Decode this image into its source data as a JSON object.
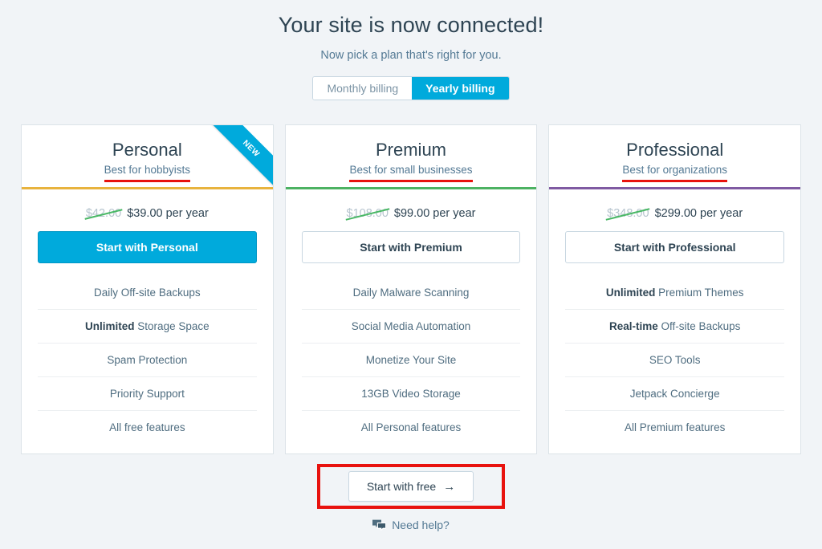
{
  "header": {
    "title": "Your site is now connected!",
    "subtitle": "Now pick a plan that's right for you."
  },
  "billing": {
    "monthly_label": "Monthly billing",
    "yearly_label": "Yearly billing",
    "selected": "Yearly billing"
  },
  "plans": [
    {
      "name": "Personal",
      "tagline": "Best for hobbyists",
      "accent_color": "#e8b33d",
      "ribbon": "NEW",
      "price_old": "$42.00",
      "price_new": "$39.00 per year",
      "cta_label": "Start with Personal",
      "cta_style": "filled",
      "features": [
        {
          "bold": "",
          "text": "Daily Off-site Backups"
        },
        {
          "bold": "Unlimited",
          "text": " Storage Space"
        },
        {
          "bold": "",
          "text": "Spam Protection"
        },
        {
          "bold": "",
          "text": "Priority Support"
        },
        {
          "bold": "",
          "text": "All free features"
        }
      ]
    },
    {
      "name": "Premium",
      "tagline": "Best for small businesses",
      "accent_color": "#4cb262",
      "ribbon": "",
      "price_old": "$108.00",
      "price_new": "$99.00 per year",
      "cta_label": "Start with Premium",
      "cta_style": "outline",
      "features": [
        {
          "bold": "",
          "text": "Daily Malware Scanning"
        },
        {
          "bold": "",
          "text": "Social Media Automation"
        },
        {
          "bold": "",
          "text": "Monetize Your Site"
        },
        {
          "bold": "",
          "text": "13GB Video Storage"
        },
        {
          "bold": "",
          "text": "All Personal features"
        }
      ]
    },
    {
      "name": "Professional",
      "tagline": "Best for organizations",
      "accent_color": "#7f5aa2",
      "ribbon": "",
      "price_old": "$348.00",
      "price_new": "$299.00 per year",
      "cta_label": "Start with Professional",
      "cta_style": "outline",
      "features": [
        {
          "bold": "Unlimited",
          "text": " Premium Themes"
        },
        {
          "bold": "Real-time",
          "text": " Off-site Backups"
        },
        {
          "bold": "",
          "text": "SEO Tools"
        },
        {
          "bold": "",
          "text": "Jetpack Concierge"
        },
        {
          "bold": "",
          "text": "All Premium features"
        }
      ]
    }
  ],
  "footer": {
    "free_label": "Start with free",
    "free_arrow": "→",
    "need_help_label": "Need help?",
    "highlight_color": "#e8120e"
  },
  "annotations": {
    "underline_color": "#e8120e"
  }
}
